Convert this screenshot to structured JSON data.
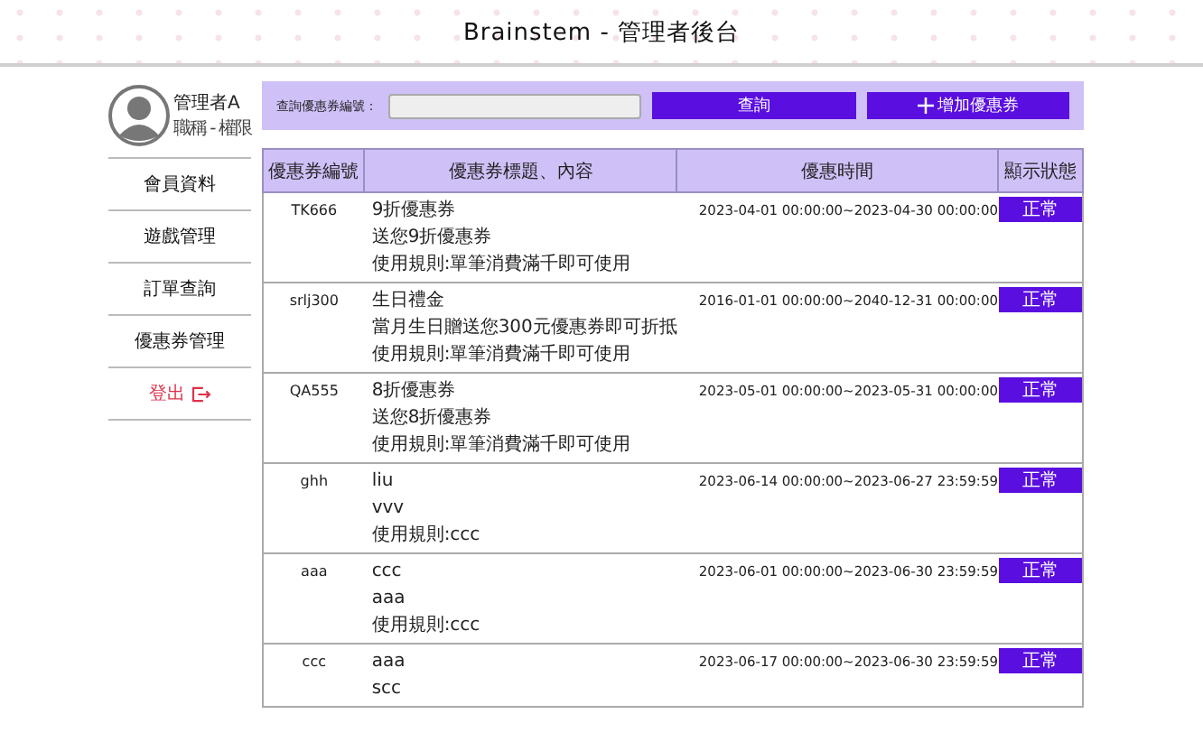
{
  "header": {
    "title": "Brainstem - 管理者後台"
  },
  "profile": {
    "name": "管理者A",
    "role": "職稱 - 權限"
  },
  "sidebar": {
    "items": [
      {
        "label": "會員資料",
        "kind": "nav"
      },
      {
        "label": "遊戲管理",
        "kind": "nav"
      },
      {
        "label": "訂單查詢",
        "kind": "nav"
      },
      {
        "label": "優惠券管理",
        "kind": "nav"
      },
      {
        "label": "登出",
        "kind": "logout"
      }
    ]
  },
  "search": {
    "label": "查詢優惠券編號：",
    "button": "查詢",
    "add_button": "增加優惠券"
  },
  "table": {
    "columns": [
      "優惠券編號",
      "優惠券標題、內容",
      "優惠時間",
      "顯示狀態"
    ],
    "rows": [
      {
        "code": "TK666",
        "lines": [
          "9折優惠券",
          "送您9折優惠券",
          "使用規則:單筆消費滿千即可使用"
        ],
        "period": "2023-04-01 00:00:00~2023-04-30 00:00:00",
        "status": "正常"
      },
      {
        "code": "srlj300",
        "lines": [
          "生日禮金",
          "當月生日贈送您300元優惠券即可折抵",
          "使用規則:單筆消費滿千即可使用"
        ],
        "period": "2016-01-01 00:00:00~2040-12-31 00:00:00",
        "status": "正常"
      },
      {
        "code": "QA555",
        "lines": [
          "8折優惠券",
          "送您8折優惠券",
          "使用規則:單筆消費滿千即可使用"
        ],
        "period": "2023-05-01 00:00:00~2023-05-31 00:00:00",
        "status": "正常"
      },
      {
        "code": "ghh",
        "lines": [
          "liu",
          "vvv",
          "使用規則:ccc"
        ],
        "period": "2023-06-14 00:00:00~2023-06-27 23:59:59",
        "status": "正常"
      },
      {
        "code": "aaa",
        "lines": [
          "ccc",
          "aaa",
          "使用規則:ccc"
        ],
        "period": "2023-06-01 00:00:00~2023-06-30 23:59:59",
        "status": "正常"
      },
      {
        "code": "ccc",
        "lines": [
          "aaa",
          "scc"
        ],
        "period": "2023-06-17 00:00:00~2023-06-30 23:59:59",
        "status": "正常"
      }
    ]
  }
}
